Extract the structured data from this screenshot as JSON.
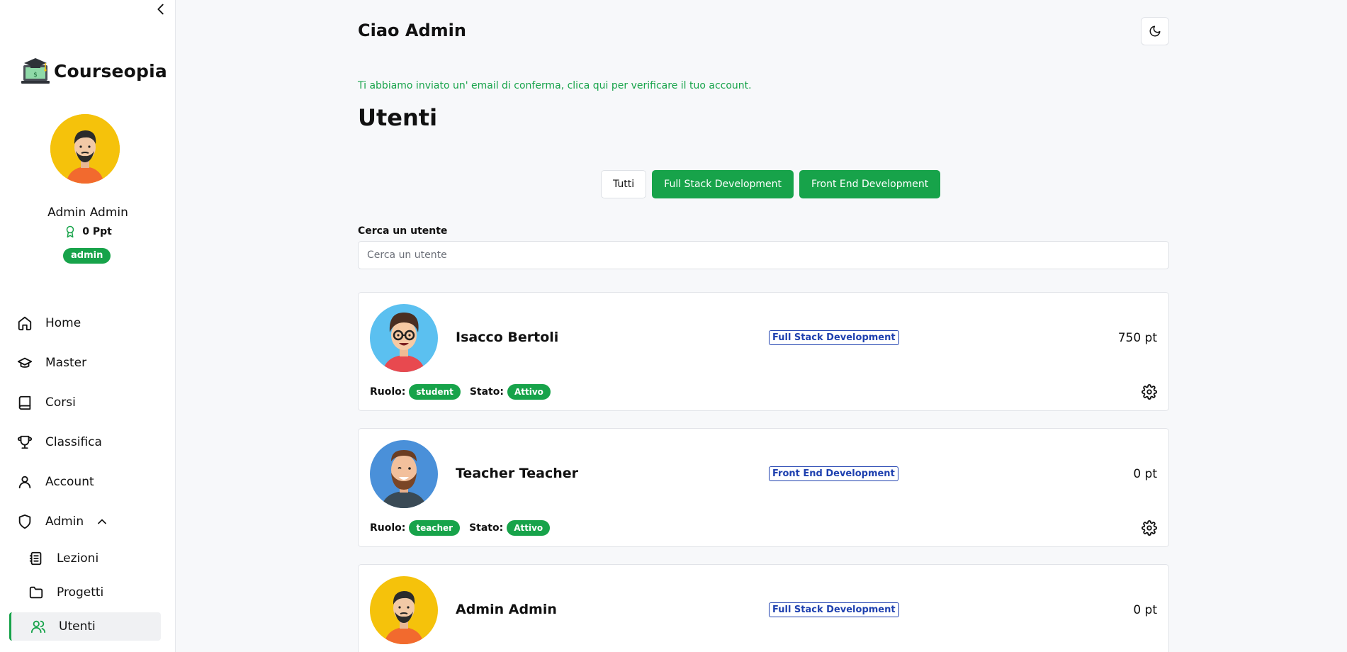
{
  "sidebar": {
    "brand": "Courseopia",
    "profile": {
      "name": "Admin Admin",
      "points": "0 Ppt",
      "role": "admin"
    },
    "nav": [
      {
        "label": "Home",
        "icon": "home-icon"
      },
      {
        "label": "Master",
        "icon": "graduation-cap-icon"
      },
      {
        "label": "Corsi",
        "icon": "book-icon"
      },
      {
        "label": "Classifica",
        "icon": "trophy-icon"
      },
      {
        "label": "Account",
        "icon": "user-icon"
      },
      {
        "label": "Admin",
        "icon": "shield-icon",
        "expanded": true
      }
    ],
    "admin_sub": [
      {
        "label": "Lezioni",
        "icon": "document-list-icon"
      },
      {
        "label": "Progetti",
        "icon": "folder-icon"
      },
      {
        "label": "Utenti",
        "icon": "users-icon",
        "active": true
      }
    ]
  },
  "header": {
    "greeting": "Ciao Admin"
  },
  "confirm_message": "Ti abbiamo inviato un' email di conferma, clica qui per verificare il tuo account.",
  "page_title": "Utenti",
  "filters": [
    "Tutti",
    "Full Stack Development",
    "Front End Development"
  ],
  "search": {
    "label": "Cerca un utente",
    "placeholder": "Cerca un utente",
    "value": ""
  },
  "labels": {
    "role": "Ruolo:",
    "status": "Stato:"
  },
  "users": [
    {
      "name": "Isacco Bertoli",
      "course": "Full Stack Development",
      "points": "750 pt",
      "role": "student",
      "status": "Attivo"
    },
    {
      "name": "Teacher Teacher",
      "course": "Front End Development",
      "points": "0 pt",
      "role": "teacher",
      "status": "Attivo"
    },
    {
      "name": "Admin Admin",
      "course": "Full Stack Development",
      "points": "0 pt",
      "role": "",
      "status": ""
    }
  ],
  "colors": {
    "accent": "#17a34a",
    "course_tag": "#1e40af",
    "background": "#f7f8fa"
  }
}
